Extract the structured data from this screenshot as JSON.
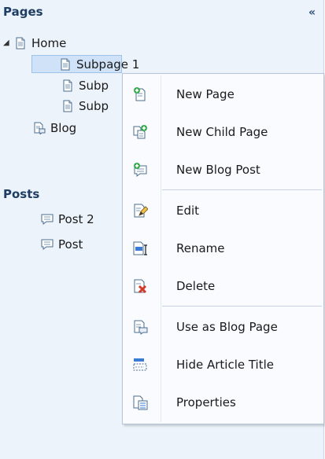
{
  "panel": {
    "title": "Pages",
    "collapse_glyph": "«"
  },
  "pages_tree": {
    "home": {
      "label": "Home",
      "expander": "◢",
      "icon": "page-icon"
    },
    "children": [
      {
        "label": "Subpage 1",
        "icon": "page-icon",
        "selected": true
      },
      {
        "label": "Subp",
        "icon": "page-icon"
      },
      {
        "label": "Subp",
        "icon": "page-icon"
      }
    ],
    "blog": {
      "label": "Blog",
      "icon": "blog-page-icon"
    }
  },
  "posts_section": {
    "title": "Posts",
    "items": [
      {
        "label": "Post 2",
        "icon": "post-icon"
      },
      {
        "label": "Post",
        "icon": "post-icon"
      }
    ]
  },
  "context_menu": {
    "items": [
      {
        "label": "New Page",
        "icon": "new-page-icon"
      },
      {
        "label": "New Child Page",
        "icon": "new-child-page-icon"
      },
      {
        "label": "New Blog Post",
        "icon": "new-blog-post-icon"
      },
      {
        "label": "Edit",
        "icon": "edit-icon"
      },
      {
        "label": "Rename",
        "icon": "rename-icon"
      },
      {
        "label": "Delete",
        "icon": "delete-icon"
      },
      {
        "label": "Use as Blog Page",
        "icon": "use-as-blog-page-icon"
      },
      {
        "label": "Hide Article Title",
        "icon": "hide-article-title-icon"
      },
      {
        "label": "Properties",
        "icon": "properties-icon"
      }
    ]
  },
  "colors": {
    "panel_bg": "#ecf3fb",
    "selection_bg": "#cfe2f8",
    "menu_bg": "#f9fbfe",
    "header_text": "#1f3d63"
  }
}
